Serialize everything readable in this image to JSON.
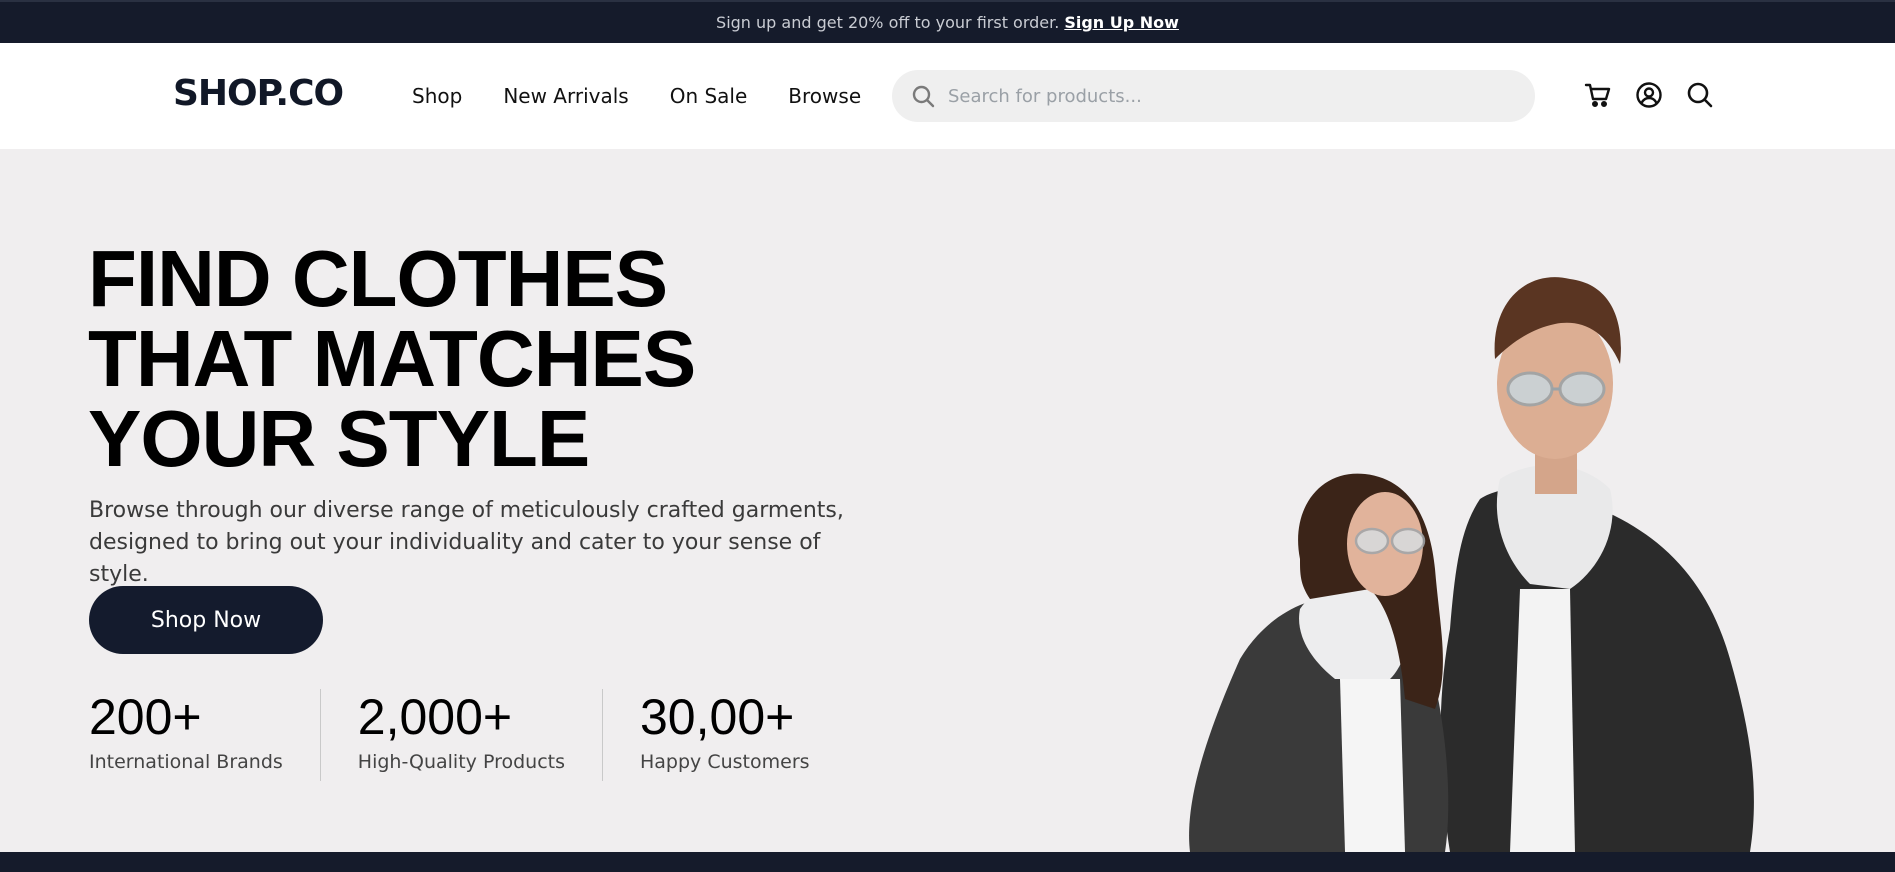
{
  "announcement": {
    "text": "Sign up and get 20% off to your first order.",
    "link": "Sign Up Now"
  },
  "header": {
    "logo": "SHOP.CO",
    "nav": [
      "Shop",
      "New Arrivals",
      "On Sale",
      "Browse"
    ],
    "search_placeholder": "Search for products...",
    "icons": [
      "cart-icon",
      "account-icon",
      "search-icon"
    ]
  },
  "hero": {
    "headline": [
      "FIND CLOTHES",
      "THAT MATCHES",
      "YOUR STYLE"
    ],
    "subtext": "Browse through our diverse range of meticulously crafted garments, designed to bring out your individuality and cater to your sense of style.",
    "cta": "Shop Now",
    "stats": [
      {
        "value": "200+",
        "label": "International Brands"
      },
      {
        "value": "2,000+",
        "label": "High-Quality Products"
      },
      {
        "value": "30,00+",
        "label": "Happy Customers"
      }
    ]
  },
  "colors": {
    "dark": "#151b2b",
    "hero_bg": "#f0eeef",
    "search_bg": "#efefef"
  }
}
